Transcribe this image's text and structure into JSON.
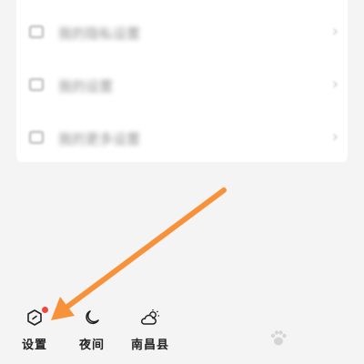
{
  "menu": {
    "items": [
      {
        "label": "我的隐私设置",
        "icon": "gear-icon"
      },
      {
        "label": "我的设置",
        "icon": "settings-icon"
      },
      {
        "label": "我的更多设置",
        "icon": "more-icon"
      }
    ]
  },
  "bottom_bar": {
    "settings_label": "设置",
    "night_label": "夜间",
    "weather_label": "南昌县"
  },
  "colors": {
    "arrow": "#f7923a",
    "badge": "#f2453d"
  }
}
